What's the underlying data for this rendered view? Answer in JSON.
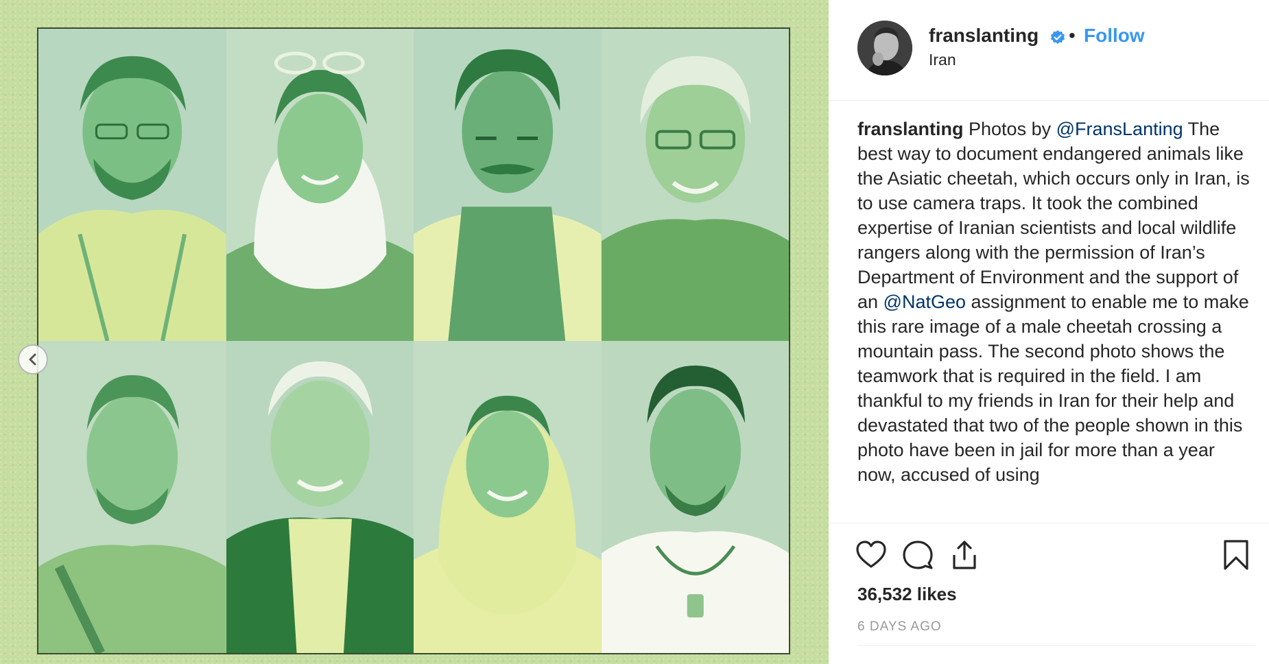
{
  "post": {
    "username": "franslanting",
    "follow_label": "Follow",
    "separator": "•",
    "location": "Iran",
    "verified_icon": "verified-badge-icon",
    "avatar_alt": "franslanting profile picture",
    "image_alt": "Illustrated portraits of eight conservationists",
    "caption": {
      "author": "franslanting",
      "part1": " Photos by ",
      "mention1": "@FransLanting",
      "part2": " The best way to document endangered animals like the Asiatic cheetah, which occurs only in Iran, is to use camera traps. It took the combined expertise of Iranian scientists and local wildlife rangers along with the permission of Iran’s Department of Environment and the support of an ",
      "mention2": "@NatGeo",
      "part3": " assignment to enable me to make this rare image of a male cheetah crossing a mountain pass. The second photo shows the teamwork that is required in the field. I am thankful to my friends in Iran for their help and devastated that two of the people shown in this photo have been in jail for more than a year now, accused of using"
    },
    "likes": "36,532 likes",
    "time_ago": "6 DAYS AGO"
  },
  "icons": {
    "prev": "chevron-left-icon",
    "like": "heart-icon",
    "comment": "comment-icon",
    "share": "share-icon",
    "save": "bookmark-icon"
  },
  "colors": {
    "follow": "#3897f0",
    "mention": "#003569",
    "muted": "#999999",
    "verified": "#3897f0",
    "media_background": "#c6dda0"
  }
}
